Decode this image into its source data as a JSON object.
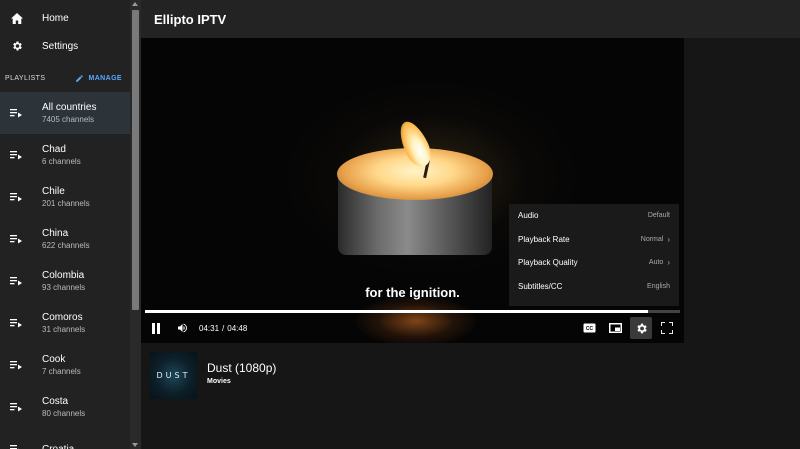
{
  "sidebar": {
    "nav": [
      {
        "label": "Home",
        "icon": "home-icon"
      },
      {
        "label": "Settings",
        "icon": "gear-icon"
      }
    ],
    "playlists_label": "PLAYLISTS",
    "manage_label": "MANAGE",
    "items": [
      {
        "name": "All countries",
        "count": "7405 channels",
        "active": true
      },
      {
        "name": "Chad",
        "count": "6 channels"
      },
      {
        "name": "Chile",
        "count": "201 channels"
      },
      {
        "name": "China",
        "count": "622 channels"
      },
      {
        "name": "Colombia",
        "count": "93 channels"
      },
      {
        "name": "Comoros",
        "count": "31 channels"
      },
      {
        "name": "Cook",
        "count": "7 channels"
      },
      {
        "name": "Costa",
        "count": "80 channels"
      },
      {
        "name": "Croatia",
        "count": ""
      }
    ]
  },
  "header": {
    "title": "Ellipto IPTV"
  },
  "player": {
    "subtitle": "for the ignition.",
    "current_time": "04:31",
    "duration": "04:48",
    "progress_fraction": 0.94,
    "settings_menu": [
      {
        "label": "Audio",
        "value": "Default",
        "chevron": false
      },
      {
        "label": "Playback Rate",
        "value": "Normal",
        "chevron": true
      },
      {
        "label": "Playback Quality",
        "value": "Auto",
        "chevron": true
      },
      {
        "label": "Subtitles/CC",
        "value": "English",
        "chevron": false
      }
    ]
  },
  "now_playing": {
    "thumb_text": "DUST",
    "title": "Dust (1080p)",
    "category": "Movies"
  },
  "colors": {
    "accent": "#5aa8ff",
    "sidebar_bg": "#222222",
    "active_item_bg": "#2c3339"
  }
}
